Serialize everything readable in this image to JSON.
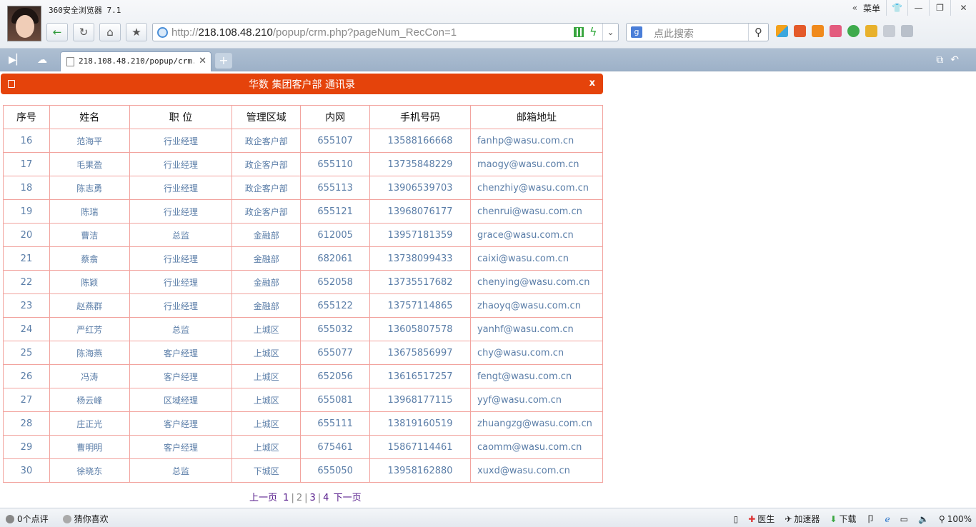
{
  "browser": {
    "title": "360安全浏览器 7.1",
    "menu_label": "菜单",
    "url_prefix": "http://",
    "url_host": "218.108.48.210",
    "url_path": "/popup/crm.php?pageNum_RecCon=1",
    "search_placeholder": "点此搜索",
    "tab_title": "218.108.48.210/popup/crm.php"
  },
  "panel": {
    "title": "华数 集团客户部 通讯录",
    "close_label": "x"
  },
  "table": {
    "headers": [
      "序号",
      "姓名",
      "职 位",
      "管理区域",
      "内网",
      "手机号码",
      "邮箱地址"
    ],
    "rows": [
      [
        "16",
        "范海平",
        "行业经理",
        "政企客户部",
        "655107",
        "13588166668",
        "fanhp@wasu.com.cn"
      ],
      [
        "17",
        "毛果盈",
        "行业经理",
        "政企客户部",
        "655110",
        "13735848229",
        "maogy@wasu.com.cn"
      ],
      [
        "18",
        "陈志勇",
        "行业经理",
        "政企客户部",
        "655113",
        "13906539703",
        "chenzhiy@wasu.com.cn"
      ],
      [
        "19",
        "陈瑞",
        "行业经理",
        "政企客户部",
        "655121",
        "13968076177",
        "chenrui@wasu.com.cn"
      ],
      [
        "20",
        "曹洁",
        "总监",
        "金融部",
        "612005",
        "13957181359",
        "grace@wasu.com.cn"
      ],
      [
        "21",
        "蔡翕",
        "行业经理",
        "金融部",
        "682061",
        "13738099433",
        "caixi@wasu.com.cn"
      ],
      [
        "22",
        "陈颖",
        "行业经理",
        "金融部",
        "652058",
        "13735517682",
        "chenying@wasu.com.cn"
      ],
      [
        "23",
        "赵燕群",
        "行业经理",
        "金融部",
        "655122",
        "13757114865",
        "zhaoyq@wasu.com.cn"
      ],
      [
        "24",
        "严红芳",
        "总监",
        "上城区",
        "655032",
        "13605807578",
        "yanhf@wasu.com.cn"
      ],
      [
        "25",
        "陈海燕",
        "客户经理",
        "上城区",
        "655077",
        "13675856997",
        "chy@wasu.com.cn"
      ],
      [
        "26",
        "冯涛",
        "客户经理",
        "上城区",
        "652056",
        "13616517257",
        "fengt@wasu.com.cn"
      ],
      [
        "27",
        "杨云峰",
        "区域经理",
        "上城区",
        "655081",
        "13968177115",
        "yyf@wasu.com.cn"
      ],
      [
        "28",
        "庄正光",
        "客户经理",
        "上城区",
        "655111",
        "13819160519",
        "zhuangzg@wasu.com.cn"
      ],
      [
        "29",
        "曹明明",
        "客户经理",
        "上城区",
        "675461",
        "15867114461",
        "caomm@wasu.com.cn"
      ],
      [
        "30",
        "徐晓东",
        "总监",
        "下城区",
        "655050",
        "13958162880",
        "xuxd@wasu.com.cn"
      ]
    ]
  },
  "pager": {
    "prev_label": "上一页",
    "pages": [
      "1",
      "2",
      "3",
      "4"
    ],
    "current_page": "2",
    "next_label": "下一页"
  },
  "statusbar": {
    "comments": "0个点评",
    "guess": "猜你喜欢",
    "doctor": "医生",
    "accelerator": "加速器",
    "download": "下载",
    "zoom": "100%"
  },
  "colors": {
    "accent": "#e5430b",
    "table_border": "#f2a39e",
    "cell_text": "#5b7ea8"
  }
}
